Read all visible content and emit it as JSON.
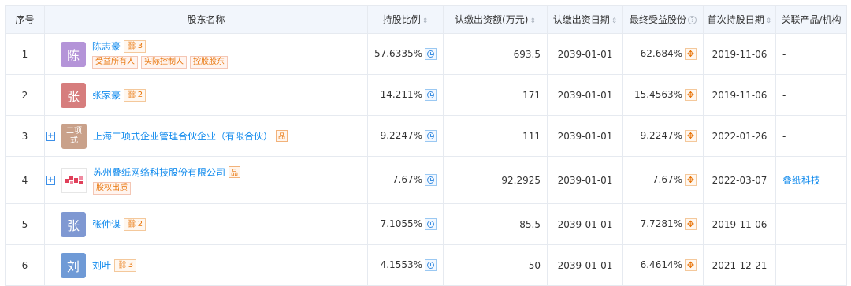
{
  "headers": {
    "idx": "序号",
    "shareholder": "股东名称",
    "ratio": "持股比例",
    "subscribed": "认缴出资额(万元)",
    "date": "认缴出资日期",
    "ultimate": "最终受益股份",
    "first_date": "首次持股日期",
    "related": "关联产品/机构"
  },
  "rows": [
    {
      "idx": "1",
      "avatar": "陈",
      "avatar_color": "#b494d8",
      "name": "陈志豪",
      "badge_icon": "⛓",
      "badge_num": "3",
      "tags": [
        "受益所有人",
        "实际控制人",
        "控股股东"
      ],
      "ratio": "57.6335%",
      "subscribed": "693.5",
      "date": "2039-01-01",
      "ultimate": "62.684%",
      "first_date": "2019-11-06",
      "related": "-"
    },
    {
      "idx": "2",
      "avatar": "张",
      "avatar_color": "#d67d7d",
      "name": "张家豪",
      "badge_icon": "⛓",
      "badge_num": "2",
      "ratio": "14.211%",
      "subscribed": "171",
      "date": "2039-01-01",
      "ultimate": "15.4563%",
      "first_date": "2019-11-06",
      "related": "-"
    },
    {
      "idx": "3",
      "avatar_l1": "二项",
      "avatar_l2": "式",
      "avatar_color": "#c9a18a",
      "name": "上海二项式企业管理合伙企业（有限合伙）",
      "corp_icon": "品",
      "ratio": "9.2247%",
      "subscribed": "111",
      "date": "2039-01-01",
      "ultimate": "9.2247%",
      "first_date": "2022-01-26",
      "related": "-"
    },
    {
      "idx": "4",
      "name": "苏州叠纸网络科技股份有限公司",
      "corp_icon": "品",
      "tags": [
        "股权出质"
      ],
      "ratio": "7.67%",
      "subscribed": "92.2925",
      "date": "2039-01-01",
      "ultimate": "7.67%",
      "first_date": "2022-03-07",
      "related": "叠纸科技"
    },
    {
      "idx": "5",
      "avatar": "张",
      "avatar_color": "#7f98d2",
      "name": "张仲谋",
      "badge_icon": "⛓",
      "badge_num": "2",
      "ratio": "7.1055%",
      "subscribed": "85.5",
      "date": "2039-01-01",
      "ultimate": "7.7281%",
      "first_date": "2019-11-06",
      "related": "-"
    },
    {
      "idx": "6",
      "avatar": "刘",
      "avatar_color": "#6f9ad6",
      "name": "刘叶",
      "badge_icon": "⛓",
      "badge_num": "3",
      "ratio": "4.1553%",
      "subscribed": "50",
      "date": "2039-01-01",
      "ultimate": "6.4614%",
      "first_date": "2021-12-21",
      "related": "-"
    }
  ],
  "plus_label": "+",
  "sort_icon": "sort-icon",
  "colors": {
    "link": "#128bed",
    "accent": "#e8750a",
    "header_bg": "#f2f6fc"
  }
}
